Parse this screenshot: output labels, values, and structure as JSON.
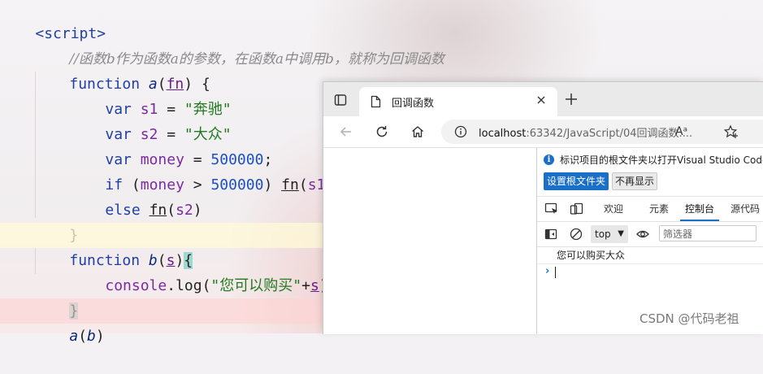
{
  "editor": {
    "lines": {
      "l0": "<script>",
      "l1": "//函数b作为函数a的参数，在函数a中调用b，就称为回调函数",
      "l2_kw": "function",
      "l2_name": "a",
      "l2_param": "fn",
      "l3_var": "s1",
      "l3_str": "\"奔驰\"",
      "l4_var": "s2",
      "l4_str": "\"大众\"",
      "l5_var": "money",
      "l5_num": "500000",
      "l6_kw": "if",
      "l6_var": "money",
      "l6_num": "500000",
      "l6_call": "fn",
      "l6_arg": "s1",
      "l7_kw": "else",
      "l7_call": "fn",
      "l7_arg": "s2",
      "l8": "}",
      "l9_kw": "function",
      "l9_name": "b",
      "l9_param": "s",
      "l10_obj": "console",
      "l10_method": "log",
      "l10_str": "\"您可以购买\"",
      "l10_param": "s",
      "l11": "}",
      "l12_name": "a",
      "l12_arg": "b"
    },
    "keyword_var": "var"
  },
  "browser": {
    "tab_title": "回调函数",
    "url_host": "localhost",
    "url_rest": ":63342/JavaScript/04回调函数....",
    "read_aloud": "Aᵃ"
  },
  "devtools": {
    "notice_text": "标识项目的根文件夹以打开Visual Studio Code中",
    "set_root_button": "设置根文件夹",
    "dont_show_button": "不再显示",
    "tabs": [
      "欢迎",
      "元素",
      "控制台",
      "源代码"
    ],
    "active_tab": "控制台",
    "context": "top",
    "filter_placeholder": "筛选器",
    "console_output": "您可以购买大众",
    "prompt": "›"
  },
  "watermark": "CSDN @代码老祖",
  "colors": {
    "accent": "#1a6fc9",
    "keyword": "#1f3fa6",
    "string": "#217a1f"
  }
}
